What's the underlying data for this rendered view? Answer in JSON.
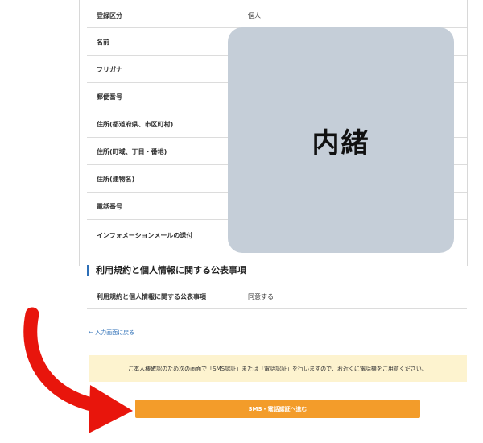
{
  "table": {
    "rows": [
      {
        "label": "登録区分",
        "value": "個人"
      },
      {
        "label": "名前",
        "value": ""
      },
      {
        "label": "フリガナ",
        "value": ""
      },
      {
        "label": "郵便番号",
        "value": ""
      },
      {
        "label": "住所(都道府県、市区町村)",
        "value": ""
      },
      {
        "label": "住所(町域、丁目・番地)",
        "value": ""
      },
      {
        "label": "住所(建物名)",
        "value": ""
      },
      {
        "label": "電話番号",
        "value": ""
      },
      {
        "label": "インフォメーションメールの送付",
        "value": ""
      }
    ]
  },
  "mask": {
    "text": "内緒"
  },
  "section": {
    "heading": "利用規約と個人情報に関する公表事項"
  },
  "terms": {
    "label": "利用規約と個人情報に関する公表事項",
    "value": "同意する"
  },
  "back_link": {
    "label": "← 入力画面に戻る"
  },
  "notice": {
    "text": "ご本人様確認のため次の画面で「SMS認証」または「電話認証」を行いますので、お近くに電話機をご用意ください。"
  },
  "cta": {
    "label": "SMS・電話認証へ進む"
  },
  "colors": {
    "accent_button": "#f39c2a",
    "notice_bg": "#fdf3cf",
    "mask": "#c5ced8",
    "arrow": "#e8150c",
    "link": "#2d6fb7"
  }
}
